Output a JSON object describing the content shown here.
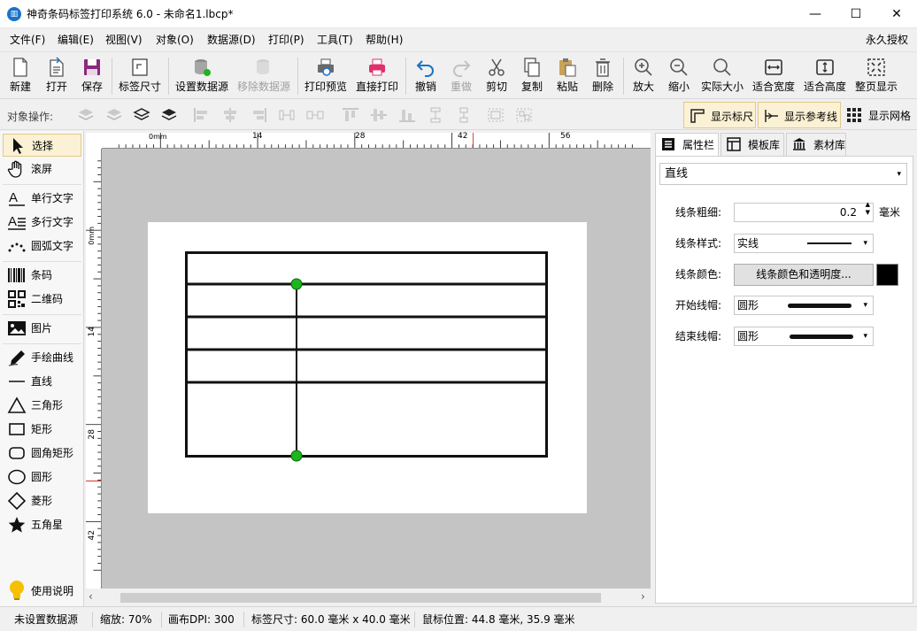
{
  "window": {
    "title": "神奇条码标签打印系统 6.0 - 未命名1.lbcp*",
    "minimize": "—",
    "maximize": "☐",
    "close": "✕"
  },
  "menu": {
    "items": [
      "文件(F)",
      "编辑(E)",
      "视图(V)",
      "对象(O)",
      "数据源(D)",
      "打印(P)",
      "工具(T)",
      "帮助(H)"
    ],
    "license": "永久授权"
  },
  "toolbar": {
    "new": "新建",
    "open": "打开",
    "save": "保存",
    "label_size": "标签尺寸",
    "set_datasource": "设置数据源",
    "remove_datasource": "移除数据源",
    "print_preview": "打印预览",
    "direct_print": "直接打印",
    "undo": "撤销",
    "redo": "重做",
    "cut": "剪切",
    "copy": "复制",
    "paste": "粘贴",
    "delete": "删除",
    "zoom_in": "放大",
    "zoom_out": "缩小",
    "actual_size": "实际大小",
    "fit_width": "适合宽度",
    "fit_height": "适合高度",
    "full_page": "整页显示"
  },
  "objbar": {
    "label": "对象操作:",
    "show_ruler": "显示标尺",
    "show_guides": "显示参考线",
    "show_grid": "显示网格"
  },
  "tools": {
    "select": "选择",
    "pan": "滚屏",
    "single_text": "单行文字",
    "multi_text": "多行文字",
    "arc_text": "圆弧文字",
    "barcode": "条码",
    "qrcode": "二维码",
    "image": "图片",
    "freehand": "手绘曲线",
    "line": "直线",
    "triangle": "三角形",
    "rectangle": "矩形",
    "rounded_rect": "圆角矩形",
    "ellipse": "圆形",
    "diamond": "菱形",
    "star": "五角星",
    "help": "使用说明"
  },
  "ruler": {
    "top_unit": "0mm",
    "top_ticks": [
      "14",
      "28",
      "42",
      "56"
    ],
    "left_unit": "0mm",
    "left_ticks": [
      "14",
      "28",
      "42"
    ]
  },
  "panel": {
    "tabs": [
      "属性栏",
      "模板库",
      "素材库"
    ],
    "object_type": "直线",
    "line_width_label": "线条粗细:",
    "line_width_value": "0.2",
    "line_width_unit": "毫米",
    "line_style_label": "线条样式:",
    "line_style_value": "实线",
    "line_color_label": "线条颜色:",
    "line_color_button": "线条颜色和透明度...",
    "line_color": "#000000",
    "start_cap_label": "开始线帽:",
    "start_cap_value": "圆形",
    "end_cap_label": "结束线帽:",
    "end_cap_value": "圆形"
  },
  "status": {
    "datasource": "未设置数据源",
    "zoom": "缩放: 70%",
    "dpi": "画布DPI: 300",
    "label_size": "标签尺寸: 60.0 毫米 x 40.0 毫米",
    "mouse_pos": "鼠标位置: 44.8 毫米, 35.9 毫米"
  },
  "colors": {
    "accent": "#1a73c8",
    "selection_handle": "#1db51d",
    "ruler_marker": "#d9372c",
    "print_red": "#e0306e"
  }
}
